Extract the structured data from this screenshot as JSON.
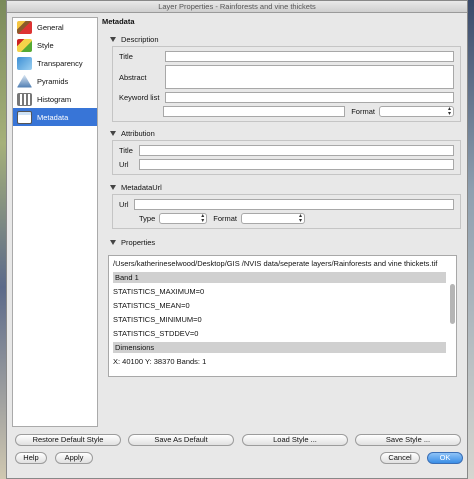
{
  "window": {
    "title": "Layer Properties - Rainforests and vine thickets"
  },
  "sidebar": {
    "items": [
      {
        "label": "General",
        "icon": "general-icon",
        "active": false
      },
      {
        "label": "Style",
        "icon": "style-icon",
        "active": false
      },
      {
        "label": "Transparency",
        "icon": "transparency-icon",
        "active": false
      },
      {
        "label": "Pyramids",
        "icon": "pyramids-icon",
        "active": false
      },
      {
        "label": "Histogram",
        "icon": "histogram-icon",
        "active": false
      },
      {
        "label": "Metadata",
        "icon": "metadata-icon",
        "active": true
      }
    ]
  },
  "metadata": {
    "title": "Metadata",
    "description": {
      "heading": "Description",
      "title_label": "Title",
      "title_value": "",
      "abstract_label": "Abstract",
      "abstract_value": "",
      "keyword_label": "Keyword list",
      "keyword_value": "",
      "extra_value": "",
      "format_label": "Format",
      "format_value": ""
    },
    "attribution": {
      "heading": "Attribution",
      "title_label": "Title",
      "title_value": "",
      "url_label": "Url",
      "url_value": ""
    },
    "metadataurl": {
      "heading": "MetadataUrl",
      "url_label": "Url",
      "url_value": "",
      "type_label": "Type",
      "type_value": "",
      "format_label": "Format",
      "format_value": ""
    },
    "properties": {
      "heading": "Properties",
      "path": "/Users/katherineselwood/Desktop/GIS /NVIS data/seperate layers/Rainforests and vine thickets.tif",
      "band_heading": "Band 1",
      "stats": [
        "STATISTICS_MAXIMUM=0",
        "STATISTICS_MEAN=0",
        "STATISTICS_MINIMUM=0",
        "STATISTICS_STDDEV=0"
      ],
      "dimensions_heading": "Dimensions",
      "dimensions_value": "X: 40100 Y: 38370 Bands: 1"
    }
  },
  "buttons": {
    "restore_default": "Restore Default Style",
    "save_as_default": "Save As Default",
    "load_style": "Load Style ...",
    "save_style": "Save Style ...",
    "help": "Help",
    "apply": "Apply",
    "cancel": "Cancel",
    "ok": "OK"
  },
  "colors": {
    "selection": "#3875d7",
    "ok_button": "#3a8ee6"
  }
}
